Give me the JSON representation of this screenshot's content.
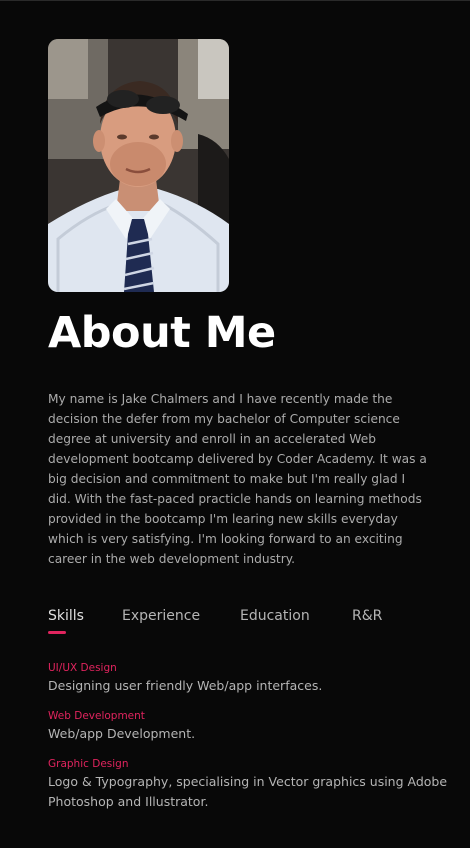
{
  "about": {
    "title": "About Me",
    "bio": "My name is Jake Chalmers and I have recently made the decision the defer from my bachelor of Computer science degree at university and enroll in an accelerated Web development bootcamp delivered by Coder Academy. It was a big decision and commitment to make but I'm really glad I did. With the fast-paced practicle hands on learning methods provided in the bootcamp I'm learing new skills everyday which is very satisfying. I'm looking forward to an exciting career in the web development industry."
  },
  "tabs": [
    {
      "label": "Skills",
      "active": true
    },
    {
      "label": "Experience",
      "active": false
    },
    {
      "label": "Education",
      "active": false
    },
    {
      "label": "R&R",
      "active": false
    }
  ],
  "skills": [
    {
      "name": "UI/UX Design",
      "description": "Designing user friendly Web/app interfaces."
    },
    {
      "name": "Web Development",
      "description": "Web/app Development."
    },
    {
      "name": "Graphic Design",
      "description": "Logo & Typography, specialising in Vector graphics using Adobe Photoshop and Illustrator."
    }
  ],
  "colors": {
    "background": "#080808",
    "accent": "#e0245e",
    "heading": "#ffffff",
    "body_text": "#ababab"
  }
}
